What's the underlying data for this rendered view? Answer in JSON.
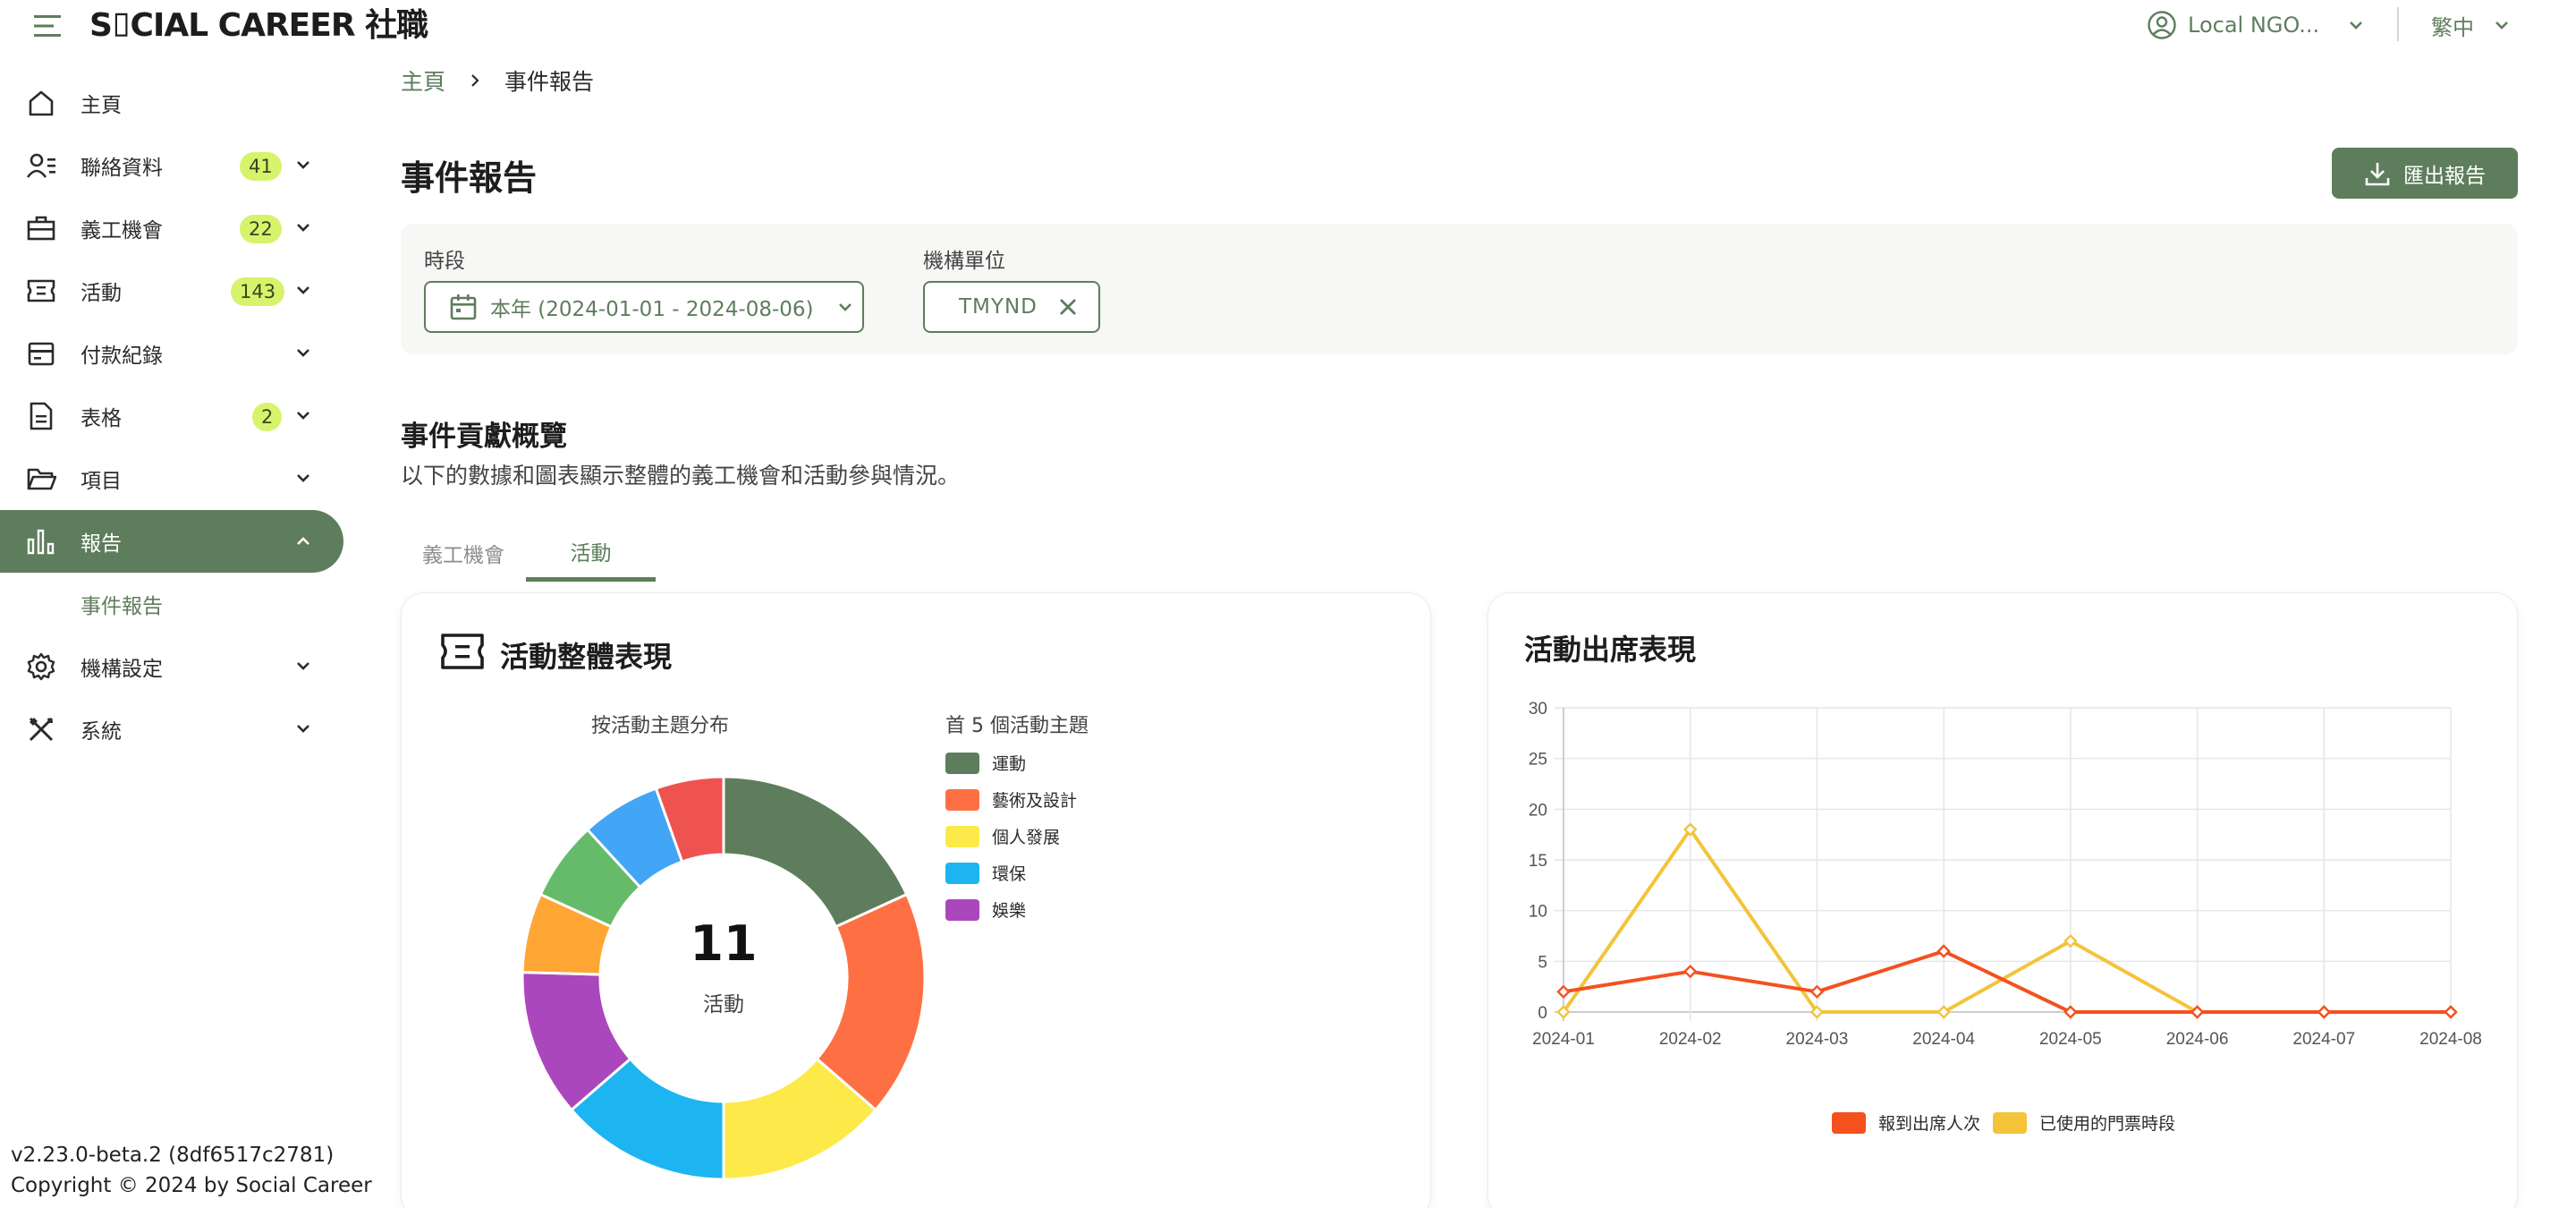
{
  "app": {
    "logo": "S⌷CIAL CAREER 社職",
    "org_selector": "Local NGO...",
    "language": "繁中"
  },
  "sidebar": {
    "items": [
      {
        "label": "主頁",
        "icon": "home-icon"
      },
      {
        "label": "聯絡資料",
        "icon": "contacts-icon",
        "badge": "41"
      },
      {
        "label": "義工機會",
        "icon": "briefcase-icon",
        "badge": "22"
      },
      {
        "label": "活動",
        "icon": "ticket-icon",
        "badge": "143"
      },
      {
        "label": "付款紀錄",
        "icon": "payment-icon"
      },
      {
        "label": "表格",
        "icon": "document-icon",
        "badge": "2"
      },
      {
        "label": "項目",
        "icon": "folder-icon"
      },
      {
        "label": "報告",
        "icon": "bar-chart-icon"
      },
      {
        "label": "機構設定",
        "icon": "gear-icon"
      },
      {
        "label": "系統",
        "icon": "tools-icon"
      }
    ],
    "sub_item": "事件報告"
  },
  "footer": {
    "version": "v2.23.0-beta.2 (8df6517c2781)",
    "copyright": "Copyright © 2024 by Social Career"
  },
  "breadcrumb": {
    "home": "主頁",
    "current": "事件報告"
  },
  "page": {
    "title": "事件報告",
    "export_label": "匯出報告"
  },
  "filters": {
    "period_label": "時段",
    "period_value": "本年 (2024-01-01 - 2024-08-06)",
    "org_label": "機構單位",
    "org_value": "TMYND"
  },
  "section": {
    "title": "事件貢獻概覽",
    "description": "以下的數據和圖表顯示整體的義工機會和活動參與情況。"
  },
  "tabs": [
    "義工機會",
    "活動"
  ],
  "activity_card": {
    "title": "活動整體表現",
    "donut_caption": "按活動主題分布",
    "legend_title": "首 5 個活動主題",
    "center_value": "11",
    "center_label": "活動"
  },
  "attendance_card": {
    "title": "活動出席表現"
  },
  "colors": {
    "brand": "#5e7d5c",
    "badge": "#d7f36b"
  },
  "chart_data": [
    {
      "type": "pie",
      "title": "按活動主題分布",
      "legend_title": "首 5 個活動主題",
      "legend": [
        "運動",
        "藝術及設計",
        "個人發展",
        "環保",
        "娛樂"
      ],
      "legend_colors": [
        "#5e7d5c",
        "#fe7043",
        "#fdea4a",
        "#1cb5f2",
        "#ab47bc"
      ],
      "slices": [
        {
          "value": 2,
          "color": "#5e7d5c"
        },
        {
          "value": 2,
          "color": "#fe7043"
        },
        {
          "value": 1.5,
          "color": "#fdea4a"
        },
        {
          "value": 1.5,
          "color": "#1cb5f2"
        },
        {
          "value": 1.3,
          "color": "#ab47bc"
        },
        {
          "value": 0.7,
          "color": "#ffa634"
        },
        {
          "value": 0.7,
          "color": "#66bb6a"
        },
        {
          "value": 0.7,
          "color": "#42a5f5"
        },
        {
          "value": 0.6,
          "color": "#ef5350"
        }
      ],
      "total": "11",
      "total_label": "活動"
    },
    {
      "type": "line",
      "title": "活動出席表現",
      "categories": [
        "2024-01",
        "2024-02",
        "2024-03",
        "2024-04",
        "2024-05",
        "2024-06",
        "2024-07",
        "2024-08"
      ],
      "ylim": [
        0,
        30
      ],
      "yticks": [
        0,
        5,
        10,
        15,
        20,
        25,
        30
      ],
      "grid": true,
      "legend_position": "bottom",
      "series": [
        {
          "name": "報到出席人次",
          "color": "#f4511e",
          "values": [
            2,
            4,
            2,
            6,
            0,
            0,
            0,
            0
          ]
        },
        {
          "name": "已使用的門票時段",
          "color": "#f3c43a",
          "values": [
            0,
            18,
            0,
            0,
            7,
            0,
            0,
            0
          ]
        }
      ]
    }
  ]
}
